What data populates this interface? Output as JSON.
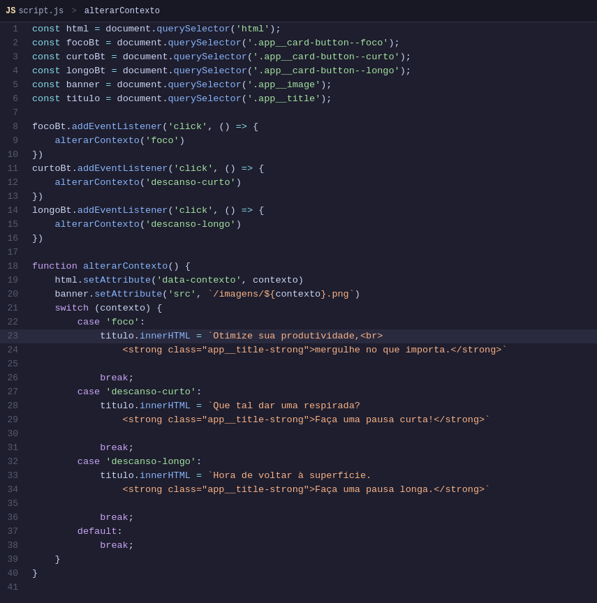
{
  "tab": {
    "file": "script.js",
    "breadcrumb_sep": ">",
    "breadcrumb_item": "alterarContexto"
  },
  "lines": [
    {
      "n": 1,
      "h": false
    },
    {
      "n": 2,
      "h": false
    },
    {
      "n": 3,
      "h": false
    },
    {
      "n": 4,
      "h": false
    },
    {
      "n": 5,
      "h": false
    },
    {
      "n": 6,
      "h": false
    },
    {
      "n": 7,
      "h": false
    },
    {
      "n": 8,
      "h": false
    },
    {
      "n": 9,
      "h": false
    },
    {
      "n": 10,
      "h": false
    },
    {
      "n": 11,
      "h": false
    },
    {
      "n": 12,
      "h": false
    },
    {
      "n": 13,
      "h": false
    },
    {
      "n": 14,
      "h": false
    },
    {
      "n": 15,
      "h": false
    },
    {
      "n": 16,
      "h": false
    },
    {
      "n": 17,
      "h": false
    },
    {
      "n": 18,
      "h": false
    },
    {
      "n": 19,
      "h": false
    },
    {
      "n": 20,
      "h": false
    },
    {
      "n": 21,
      "h": false
    },
    {
      "n": 22,
      "h": false
    },
    {
      "n": 23,
      "h": true
    },
    {
      "n": 24,
      "h": false
    },
    {
      "n": 25,
      "h": false
    },
    {
      "n": 26,
      "h": false
    },
    {
      "n": 27,
      "h": false
    },
    {
      "n": 28,
      "h": false
    },
    {
      "n": 29,
      "h": false
    },
    {
      "n": 30,
      "h": false
    },
    {
      "n": 31,
      "h": false
    },
    {
      "n": 32,
      "h": false
    },
    {
      "n": 33,
      "h": false
    },
    {
      "n": 34,
      "h": false
    },
    {
      "n": 35,
      "h": false
    },
    {
      "n": 36,
      "h": false
    },
    {
      "n": 37,
      "h": false
    },
    {
      "n": 38,
      "h": false
    },
    {
      "n": 39,
      "h": false
    },
    {
      "n": 40,
      "h": false
    },
    {
      "n": 41,
      "h": false
    }
  ]
}
